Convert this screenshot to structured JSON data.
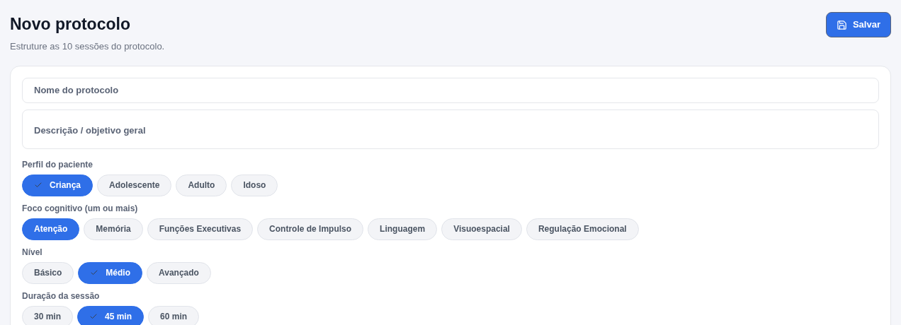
{
  "header": {
    "title": "Novo protocolo",
    "subtitle": "Estruture as 10 sessões do protocolo.",
    "save_button": "Salvar"
  },
  "fields": [
    {
      "kind": "input",
      "placeholder": "Nome do protocolo"
    },
    {
      "kind": "textarea",
      "placeholder": "Descrição / objetivo geral"
    }
  ],
  "groups": [
    {
      "label": "Perfil do paciente",
      "kind": "single",
      "options": [
        {
          "label": "Criança",
          "selected": true
        },
        {
          "label": "Adolescente",
          "selected": false
        },
        {
          "label": "Adulto",
          "selected": false
        },
        {
          "label": "Idoso",
          "selected": false
        }
      ]
    },
    {
      "label": "Foco cognitivo (um ou mais)",
      "kind": "multi",
      "options": [
        {
          "label": "Atenção",
          "selected": true
        },
        {
          "label": "Memória",
          "selected": false
        },
        {
          "label": "Funções Executivas",
          "selected": false
        },
        {
          "label": "Controle de Impulso",
          "selected": false
        },
        {
          "label": "Linguagem",
          "selected": false
        },
        {
          "label": "Visuoespacial",
          "selected": false
        },
        {
          "label": "Regulação Emocional",
          "selected": false
        }
      ]
    },
    {
      "label": "Nível",
      "kind": "single",
      "options": [
        {
          "label": "Básico",
          "selected": false
        },
        {
          "label": "Médio",
          "selected": true
        },
        {
          "label": "Avançado",
          "selected": false
        }
      ]
    },
    {
      "label": "Duração da sessão",
      "kind": "single",
      "options": [
        {
          "label": "30 min",
          "selected": false
        },
        {
          "label": "45 min",
          "selected": true
        },
        {
          "label": "60 min",
          "selected": false
        }
      ]
    }
  ]
}
